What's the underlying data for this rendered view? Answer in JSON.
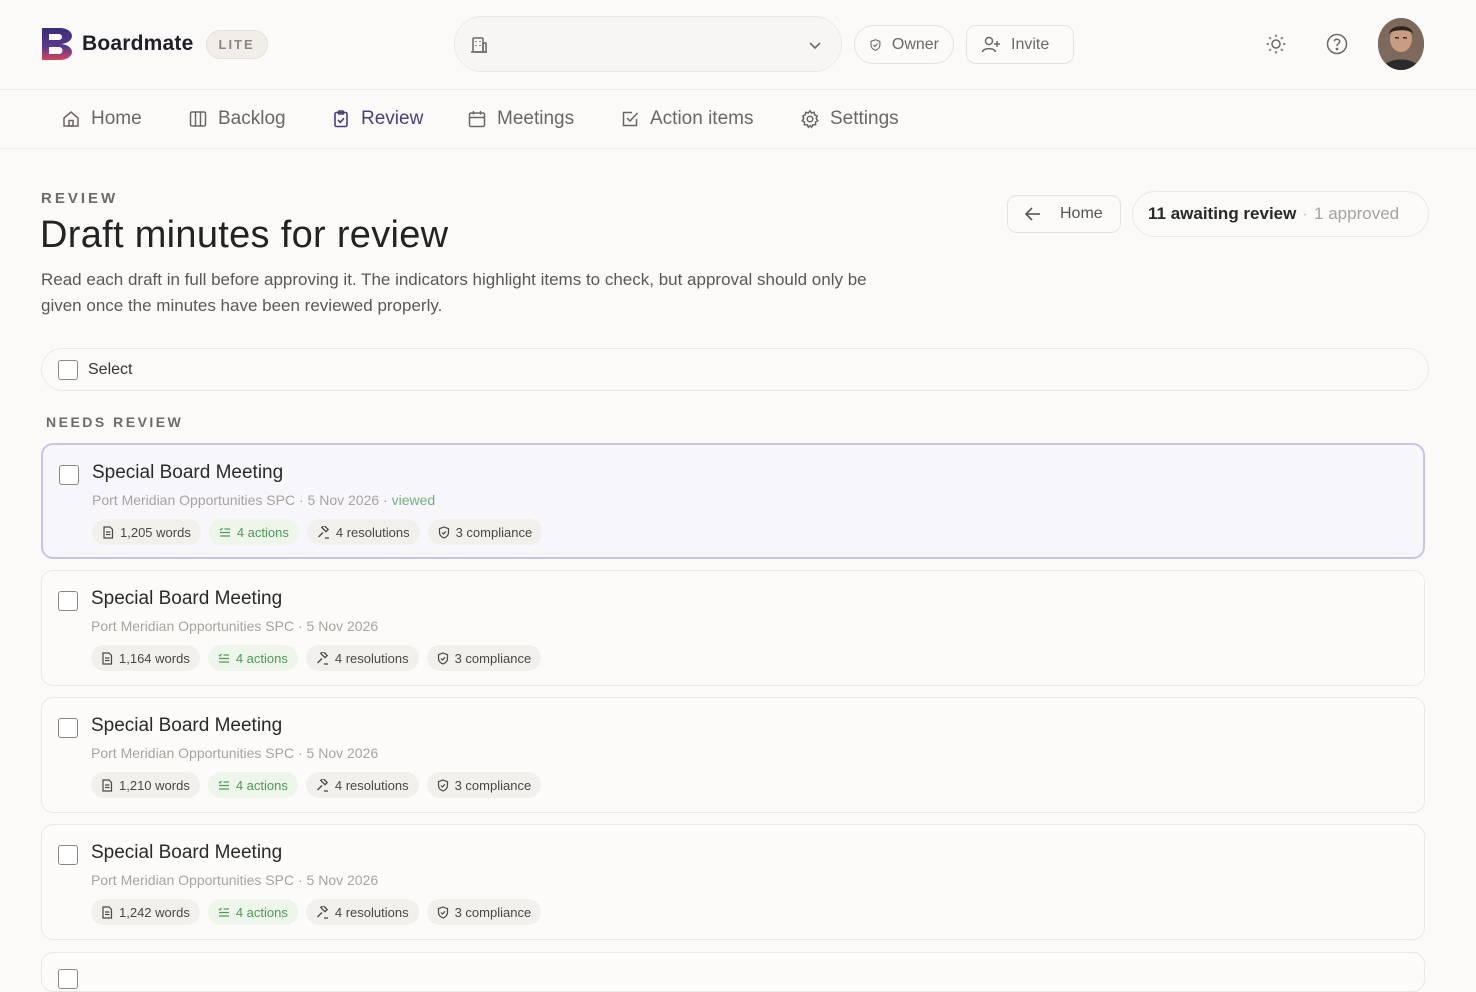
{
  "brand": {
    "name": "Boardmate",
    "badge": "LITE",
    "colors": {
      "logo_top": "#3b2b7a",
      "logo_bottom": "#d2455a"
    }
  },
  "header": {
    "org_select": {
      "value": "",
      "icon": "building-icon"
    },
    "owner_label": "Owner",
    "invite_label": "Invite",
    "icons": [
      "sun-icon",
      "help-icon"
    ]
  },
  "nav": [
    {
      "label": "Home",
      "icon": "home-icon",
      "active": false
    },
    {
      "label": "Backlog",
      "icon": "columns-icon",
      "active": false
    },
    {
      "label": "Review",
      "icon": "clipboard-check-icon",
      "active": true
    },
    {
      "label": "Meetings",
      "icon": "calendar-icon",
      "active": false
    },
    {
      "label": "Action items",
      "icon": "checkbox-icon",
      "active": false
    },
    {
      "label": "Settings",
      "icon": "gear-icon",
      "active": false
    }
  ],
  "page": {
    "eyebrow": "REVIEW",
    "title": "Draft minutes for review",
    "description": "Read each draft in full before approving it. The indicators highlight items to check, but approval should only be given once the minutes have been reviewed properly.",
    "home_button": "Home",
    "summary": {
      "awaiting": "11 awaiting review",
      "separator": "·",
      "approved": "1 approved"
    }
  },
  "select_bar": {
    "label": "Select"
  },
  "section": {
    "label": "NEEDS REVIEW"
  },
  "cards": [
    {
      "title": "Special Board Meeting",
      "org": "Port Meridian Opportunities SPC",
      "date": "5 Nov 2026",
      "viewed": "· viewed",
      "words": "1,205 words",
      "actions": "4 actions",
      "resolutions": "4 resolutions",
      "compliance": "3 compliance"
    },
    {
      "title": "Special Board Meeting",
      "org": "Port Meridian Opportunities SPC",
      "date": "5 Nov 2026",
      "viewed": "",
      "words": "1,164 words",
      "actions": "4 actions",
      "resolutions": "4 resolutions",
      "compliance": "3 compliance"
    },
    {
      "title": "Special Board Meeting",
      "org": "Port Meridian Opportunities SPC",
      "date": "5 Nov 2026",
      "viewed": "",
      "words": "1,210 words",
      "actions": "4 actions",
      "resolutions": "4 resolutions",
      "compliance": "3 compliance"
    },
    {
      "title": "Special Board Meeting",
      "org": "Port Meridian Opportunities SPC",
      "date": "5 Nov 2026",
      "viewed": "",
      "words": "1,242 words",
      "actions": "4 actions",
      "resolutions": "4 resolutions",
      "compliance": "3 compliance"
    }
  ],
  "meta_separator": "·"
}
